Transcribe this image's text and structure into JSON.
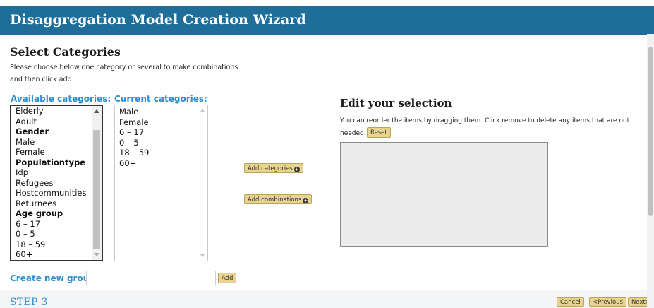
{
  "window": {
    "title": "Disaggregation Model Creation Wizard"
  },
  "select": {
    "heading": "Select Categories",
    "instructions": "Please choose below one category or several to make combinations and then click add:"
  },
  "available": {
    "label": "Available categories:",
    "items": [
      {
        "text": "Elderly",
        "bold": false
      },
      {
        "text": "Adult",
        "bold": false
      },
      {
        "text": "Gender",
        "bold": true
      },
      {
        "text": "Male",
        "bold": false
      },
      {
        "text": "Female",
        "bold": false
      },
      {
        "text": "Populationtype",
        "bold": true
      },
      {
        "text": "Idp",
        "bold": false
      },
      {
        "text": "Refugees",
        "bold": false
      },
      {
        "text": "Hostcommunities",
        "bold": false
      },
      {
        "text": "Returnees",
        "bold": false
      },
      {
        "text": "Age group",
        "bold": true
      },
      {
        "text": "6 – 17",
        "bold": false
      },
      {
        "text": "0 – 5",
        "bold": false
      },
      {
        "text": "18 – 59",
        "bold": false
      },
      {
        "text": "60+",
        "bold": false
      }
    ]
  },
  "current": {
    "label": "Current categories:",
    "items": [
      "Male",
      "Female",
      "6 – 17",
      "0 – 5",
      "18 – 59",
      "60+"
    ]
  },
  "actions": {
    "add_categories": "Add categories",
    "add_combinations": "Add combinations"
  },
  "edit": {
    "heading": "Edit your selection",
    "description": "You can reorder the items by dragging them. Click remove to delete any items that are not needed.",
    "reset": "Reset"
  },
  "create_group": {
    "label": "Create new group:",
    "value": "",
    "add": "Add"
  },
  "footer": {
    "step": "STEP 3",
    "cancel": "Cancel",
    "previous": "<Previous",
    "next": "Next>"
  },
  "colors": {
    "title_bar": "#1f6e99",
    "accent_blue": "#2f8fcf",
    "button_gold": "#e8d48e"
  },
  "icons": {
    "plus": "plus-circle-icon"
  }
}
